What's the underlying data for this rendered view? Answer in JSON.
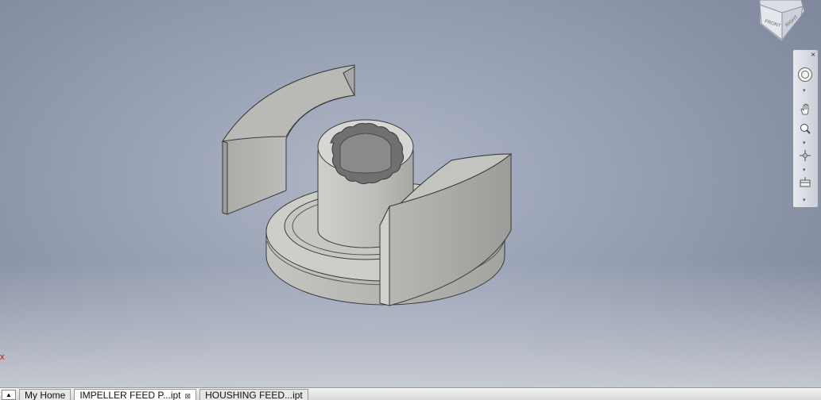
{
  "viewcube": {
    "front_label": "FRONT",
    "right_label": "RIGHT"
  },
  "navbar": {
    "close_glyph": "×",
    "tools": [
      "steering-wheel-icon",
      "pan-icon",
      "zoom-icon",
      "orbit-icon",
      "look-at-icon"
    ]
  },
  "axis": {
    "x_label": "x"
  },
  "tabs": [
    {
      "label": "My Home",
      "active": false,
      "closable": false
    },
    {
      "label": "IMPELLER FEED P...ipt",
      "active": true,
      "closable": true
    },
    {
      "label": "HOUSHING FEED...ipt",
      "active": false,
      "closable": false
    }
  ],
  "tab_close_glyph": "⊠",
  "tab_scroll_glyph": "▲",
  "colors": {
    "model_face": "#c8c8c4",
    "model_dark": "#8f8f8c",
    "background": "#9aa3b6"
  }
}
